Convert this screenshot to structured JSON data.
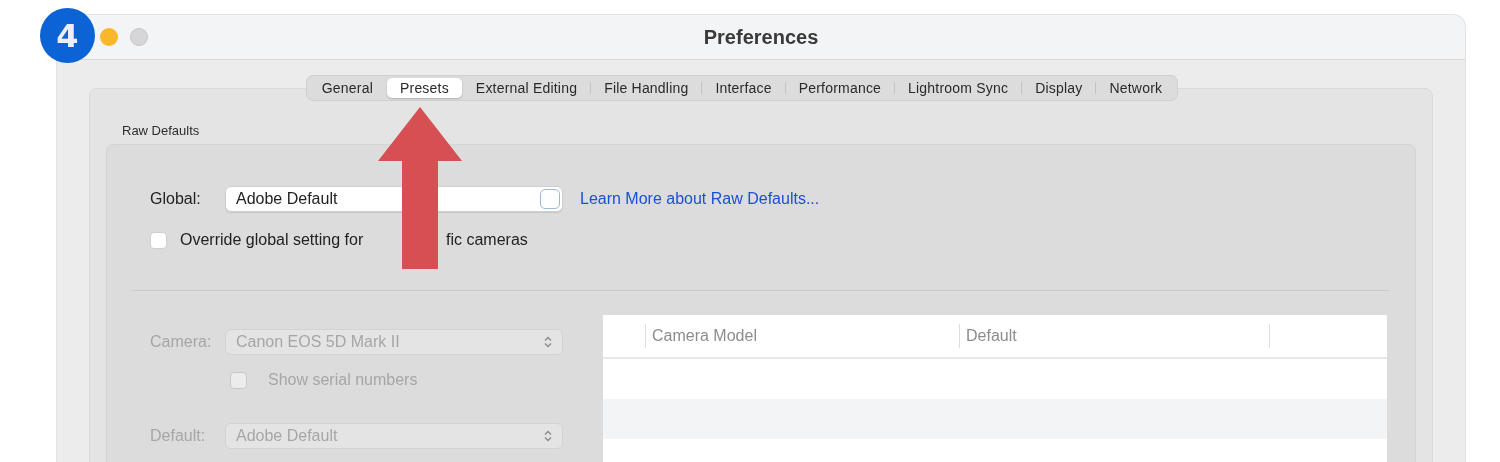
{
  "step_badge": "4",
  "window": {
    "title": "Preferences"
  },
  "tabs": [
    {
      "label": "General",
      "selected": false
    },
    {
      "label": "Presets",
      "selected": true
    },
    {
      "label": "External Editing",
      "selected": false
    },
    {
      "label": "File Handling",
      "selected": false
    },
    {
      "label": "Interface",
      "selected": false
    },
    {
      "label": "Performance",
      "selected": false
    },
    {
      "label": "Lightroom Sync",
      "selected": false
    },
    {
      "label": "Display",
      "selected": false
    },
    {
      "label": "Network",
      "selected": false
    }
  ],
  "section_title": "Raw Defaults",
  "global": {
    "label": "Global:",
    "value": "Adobe Default",
    "disabled": false
  },
  "learn_more_link": "Learn More about Raw Defaults...",
  "override_checkbox": {
    "label_before_arrow": "Override global setting for",
    "label_after_arrow": "fic cameras",
    "checked": false,
    "disabled": false
  },
  "camera": {
    "label": "Camera:",
    "value": "Canon EOS 5D Mark II",
    "disabled": true
  },
  "serial_checkbox": {
    "label": "Show serial numbers",
    "checked": false,
    "disabled": true
  },
  "default": {
    "label": "Default:",
    "value": "Adobe Default",
    "disabled": true
  },
  "table": {
    "columns": [
      "Camera Model",
      "Default"
    ]
  }
}
